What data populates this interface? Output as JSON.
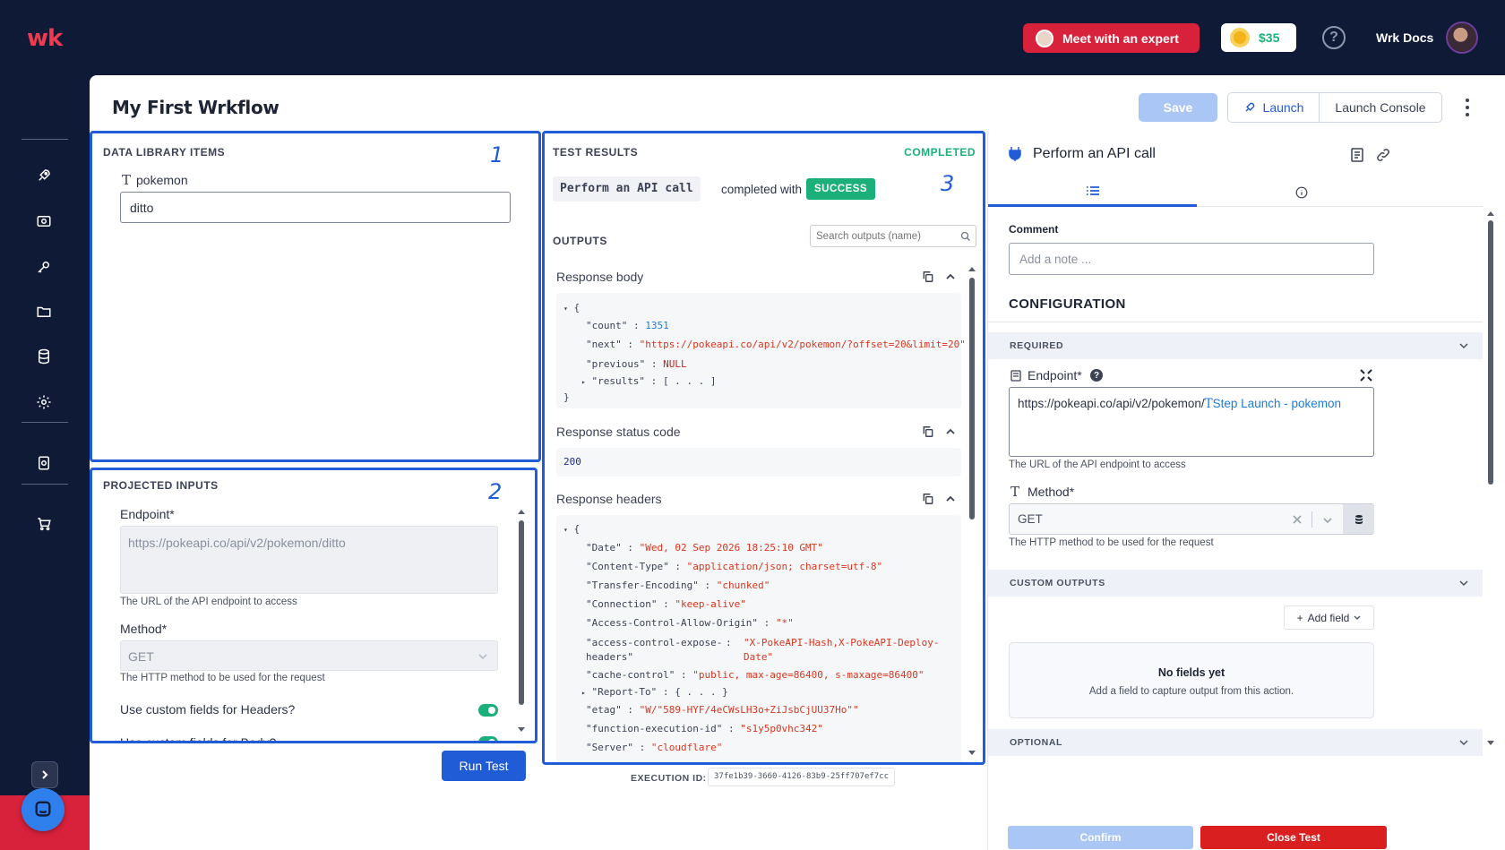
{
  "topbar": {
    "logo": "wk",
    "expert_button": "Meet with an expert",
    "credits": "$35",
    "help": "?",
    "user_name": "Wrk Docs"
  },
  "workflow": {
    "title": "My First Wrkflow",
    "save_label": "Save",
    "launch_label": "Launch",
    "console_label": "Launch Console"
  },
  "data_library": {
    "title": "DATA LIBRARY ITEMS",
    "annotation": "1",
    "item_label": "pokemon",
    "item_value": "ditto"
  },
  "projected_inputs": {
    "title": "PROJECTED INPUTS",
    "annotation": "2",
    "endpoint_label": "Endpoint*",
    "endpoint_value": "https://pokeapi.co/api/v2/pokemon/ditto",
    "endpoint_help": "The URL of the API endpoint to access",
    "method_label": "Method*",
    "method_value": "GET",
    "method_help": "The HTTP method to be used for the request",
    "custom_headers_label": "Use custom fields for Headers?",
    "custom_body_label": "Use custom fields for Body?",
    "run_test": "Run Test"
  },
  "test_results": {
    "title": "TEST RESULTS",
    "status": "COMPLETED",
    "annotation": "3",
    "action_name": "Perform an API call",
    "completed_with": "completed with",
    "badge": "SUCCESS",
    "outputs_title": "OUTPUTS",
    "search_placeholder": "Search outputs (name)",
    "response_body_label": "Response body",
    "response_status_label": "Response status code",
    "status_code": "200",
    "response_headers_label": "Response headers",
    "execution_id_label": "EXECUTION ID:",
    "execution_id": "37fe1b39-3660-4126-83b9-25ff707ef7cc",
    "body": {
      "count_key": "\"count\"",
      "count_val": "1351",
      "next_key": "\"next\"",
      "next_val": "\"https://pokeapi.co/api/v2/pokemon/?offset=20&limit=20\"",
      "previous_key": "\"previous\"",
      "previous_val": "NULL",
      "results_key": "\"results\"",
      "results_val": "[ . . . ]"
    },
    "headers": [
      {
        "k": "\"Date\"",
        "v": "\"Wed, 02 Sep 2026 18:25:10 GMT\""
      },
      {
        "k": "\"Content-Type\"",
        "v": "\"application/json; charset=utf-8\""
      },
      {
        "k": "\"Transfer-Encoding\"",
        "v": "\"chunked\""
      },
      {
        "k": "\"Connection\"",
        "v": "\"keep-alive\""
      },
      {
        "k": "\"Access-Control-Allow-Origin\"",
        "v": "\"*\""
      },
      {
        "k": "\"access-control-expose-headers\"",
        "v": "\"X-PokeAPI-Hash,X-PokeAPI-Deploy-Date\""
      },
      {
        "k": "\"cache-control\"",
        "v": "\"public, max-age=86400, s-maxage=86400\""
      },
      {
        "k": "\"Report-To\"",
        "v": "{ . . . }"
      },
      {
        "k": "\"etag\"",
        "v": "\"W/\"589-HYF/4eCWsLH3o+ZiJsbCjUU37Ho\"\""
      },
      {
        "k": "\"function-execution-id\"",
        "v": "\"s1y5p0vhc342\""
      },
      {
        "k": "\"Server\"",
        "v": "\"cloudflare\""
      }
    ]
  },
  "step_panel": {
    "title": "Perform an API call",
    "comment_label": "Comment",
    "comment_placeholder": "Add a note ...",
    "configuration": "CONFIGURATION",
    "required": "REQUIRED",
    "endpoint_label": "Endpoint*",
    "endpoint_prefix": "https://pokeapi.co/api/v2/pokemon/",
    "endpoint_token": "Step Launch - pokemon",
    "endpoint_help": "The URL of the API endpoint to access",
    "method_label": "Method*",
    "method_value": "GET",
    "method_help": "The HTTP method to be used for the request",
    "custom_outputs": "CUSTOM OUTPUTS",
    "add_field": "Add field",
    "no_fields_title": "No fields yet",
    "no_fields_desc": "Add a field to capture output from this action.",
    "optional": "OPTIONAL",
    "confirm": "Confirm",
    "close_test": "Close Test"
  },
  "colors": {
    "accent": "#1f5cd6",
    "brand_red": "#d8213b",
    "success": "#1bb07a",
    "nav_bg": "#0f1a36"
  }
}
